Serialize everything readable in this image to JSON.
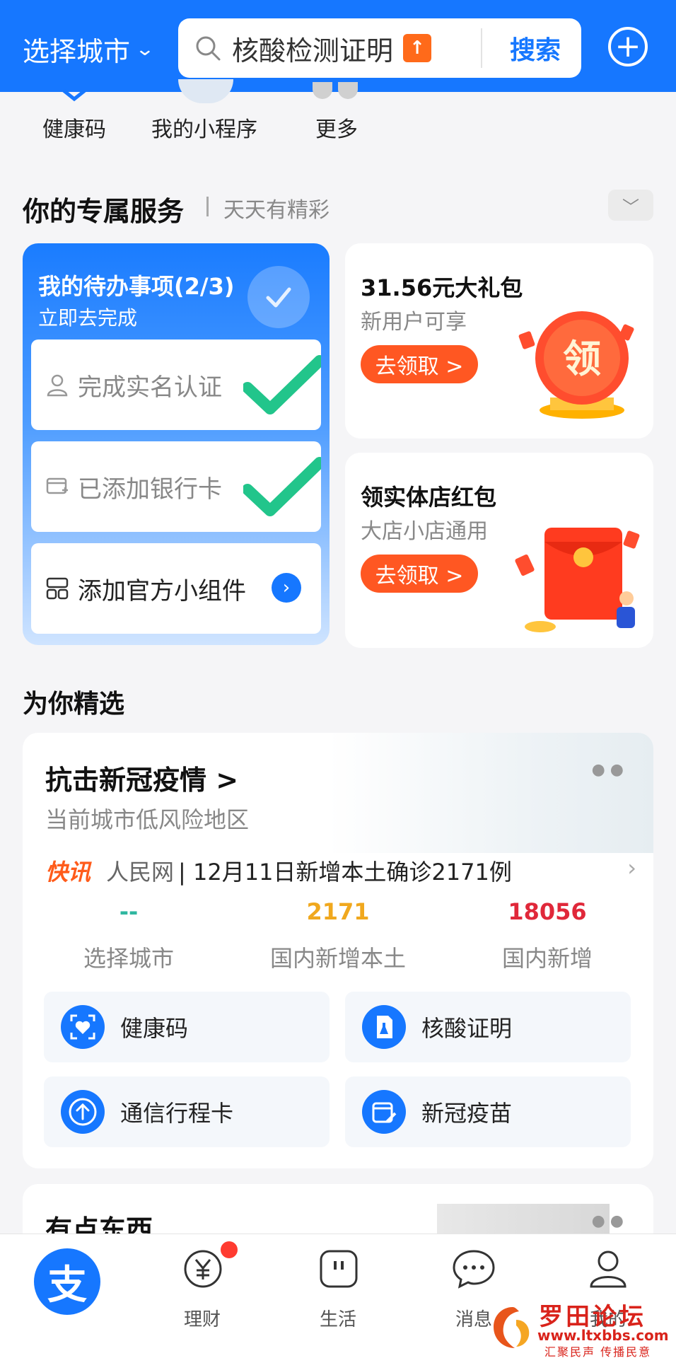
{
  "header": {
    "city_label": "选择城市",
    "search_query": "核酸检测证明",
    "search_button": "搜索"
  },
  "quick_apps": [
    {
      "label": "健康码"
    },
    {
      "label": "我的小程序"
    },
    {
      "label": "更多"
    }
  ],
  "services_section": {
    "title": "你的专属服务",
    "subtitle": "天天有精彩"
  },
  "todo": {
    "title": "我的待办事项(2/3)",
    "subtitle": "立即去完成",
    "items": [
      {
        "label": "完成实名认证",
        "done": true
      },
      {
        "label": "已添加银行卡",
        "done": true
      },
      {
        "label": "添加官方小组件",
        "done": false
      }
    ]
  },
  "promos": [
    {
      "title": "31.56元大礼包",
      "subtitle": "新用户可享",
      "button": "去领取 >",
      "icon_text": "领"
    },
    {
      "title": "领实体店红包",
      "subtitle": "大店小店通用",
      "button": "去领取 >"
    }
  ],
  "featured": {
    "title": "为你精选"
  },
  "covid": {
    "title": "抗击新冠疫情 >",
    "subtitle": "当前城市低风险地区",
    "news_tag": "快讯",
    "news_source": "人民网",
    "news_text": "| 12月11日新增本土确诊2171例",
    "stats": [
      {
        "value": "--",
        "label": "选择城市",
        "color": "#2fb7a0"
      },
      {
        "value": "2171",
        "label": "国内新增本土",
        "color": "#f0a81e"
      },
      {
        "value": "18056",
        "label": "国内新增",
        "color": "#e0283a"
      }
    ],
    "services": [
      {
        "label": "健康码",
        "icon": "health-code-icon"
      },
      {
        "label": "核酸证明",
        "icon": "nucleic-test-icon"
      },
      {
        "label": "通信行程卡",
        "icon": "travel-card-icon"
      },
      {
        "label": "新冠疫苗",
        "icon": "vaccine-icon"
      }
    ]
  },
  "more_card": {
    "title": "有点东西"
  },
  "tabbar": {
    "tabs": [
      {
        "label": "",
        "icon": "alipay-home-icon"
      },
      {
        "label": "理财",
        "icon": "wealth-icon"
      },
      {
        "label": "生活",
        "icon": "life-icon"
      },
      {
        "label": "消息",
        "icon": "message-icon"
      },
      {
        "label": "我的",
        "icon": "profile-icon"
      }
    ]
  },
  "watermark": {
    "title": "罗田论坛",
    "url": "www.ltxbbs.com",
    "slogan": "汇聚民声 传播民意"
  },
  "colors": {
    "brand_blue": "#1677ff",
    "promo_orange": "#ff5722",
    "check_green": "#22c58b"
  }
}
